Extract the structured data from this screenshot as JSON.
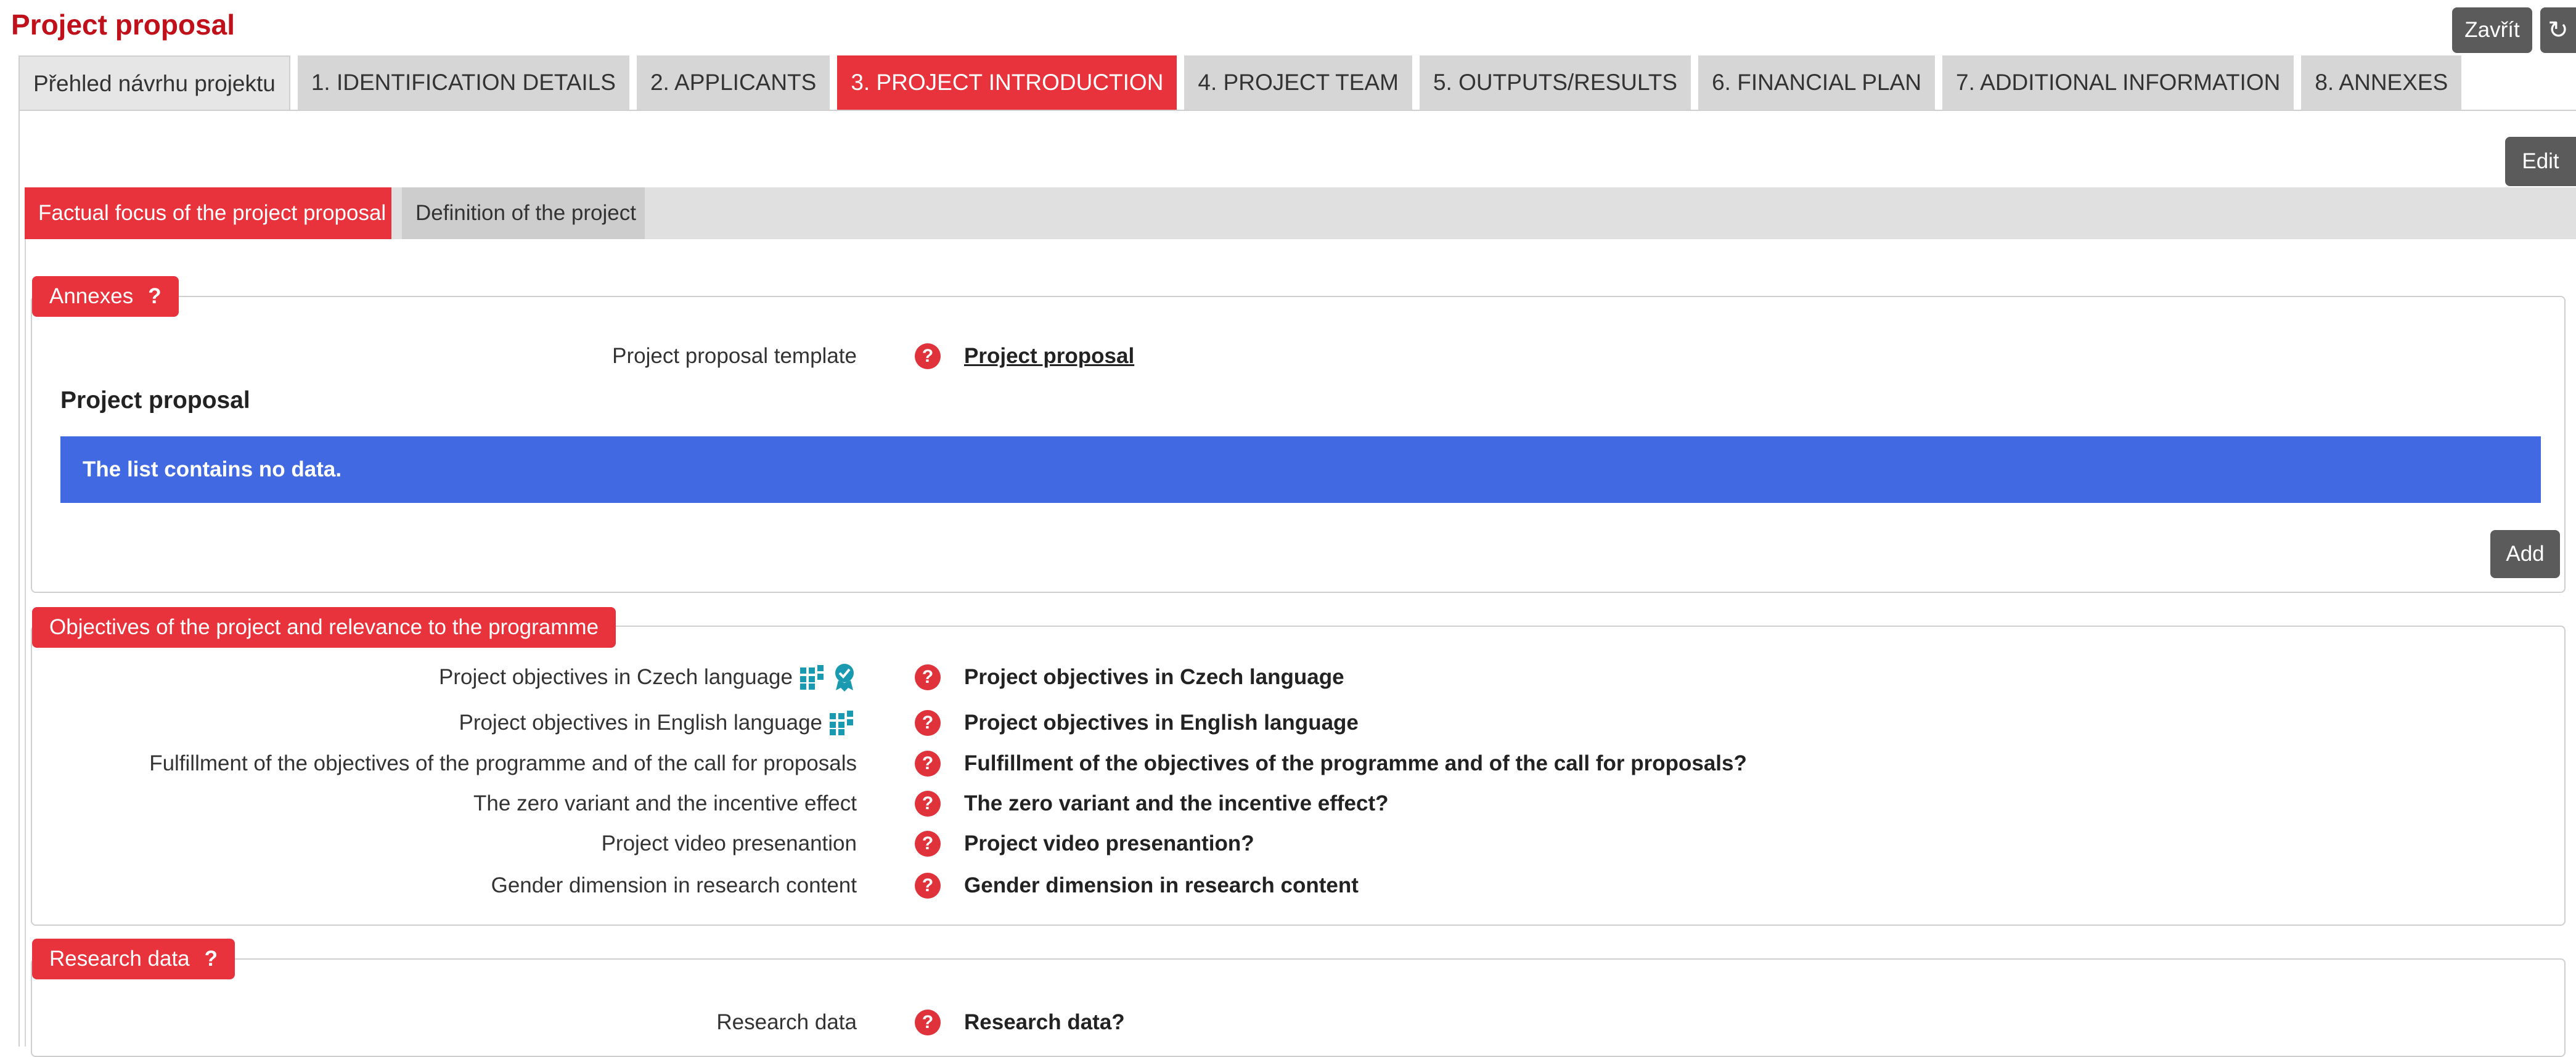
{
  "header": {
    "title": "Project proposal",
    "close_label": "Zavřít",
    "refresh_label": "↻"
  },
  "tabs": [
    {
      "label": "Přehled návrhu projektu"
    },
    {
      "label": "1. IDENTIFICATION DETAILS"
    },
    {
      "label": "2. APPLICANTS"
    },
    {
      "label": "3. PROJECT INTRODUCTION",
      "active": true
    },
    {
      "label": "4. PROJECT TEAM"
    },
    {
      "label": "5. OUTPUTS/RESULTS"
    },
    {
      "label": "6. FINANCIAL PLAN"
    },
    {
      "label": "7. ADDITIONAL INFORMATION"
    },
    {
      "label": "8. ANNEXES"
    }
  ],
  "toolbar": {
    "edit_label": "Edit"
  },
  "subtabs": [
    {
      "label": "Factual focus of the project proposal",
      "active": true
    },
    {
      "label": "Definition of the project"
    }
  ],
  "annexes": {
    "legend": "Annexes",
    "help": "?",
    "template_label": "Project proposal template",
    "template_value": "Project proposal",
    "heading": "Project proposal",
    "empty_message": "The list contains no data.",
    "add_label": "Add"
  },
  "objectives": {
    "legend": "Objectives of the project and relevance to the programme",
    "rows": [
      {
        "label": "Project objectives in Czech language",
        "value": "Project objectives in Czech language",
        "icons": [
          "grid-icon",
          "badge-icon"
        ]
      },
      {
        "label": "Project objectives in English language",
        "value": "Project objectives in English language",
        "icons": [
          "grid-icon"
        ]
      },
      {
        "label": "Fulfillment of the objectives of the programme and of the call for proposals",
        "value": "Fulfillment of the objectives of the programme and of the call for proposals?"
      },
      {
        "label": "The zero variant and the incentive effect",
        "value": "The zero variant and the incentive effect?"
      },
      {
        "label": "Project video presenantion",
        "value": "Project video presenantion?"
      },
      {
        "label": "Gender dimension in research content",
        "value": "Gender dimension in research content"
      }
    ]
  },
  "research_data": {
    "legend": "Research data",
    "help": "?",
    "label": "Research data",
    "value": "Research data?"
  },
  "help_glyph": "?",
  "colors": {
    "accent": "#e8323c",
    "title": "#c0101a",
    "info_banner": "#4169e1",
    "button": "#5b5b5b",
    "icon_teal": "#1a9ab0"
  }
}
